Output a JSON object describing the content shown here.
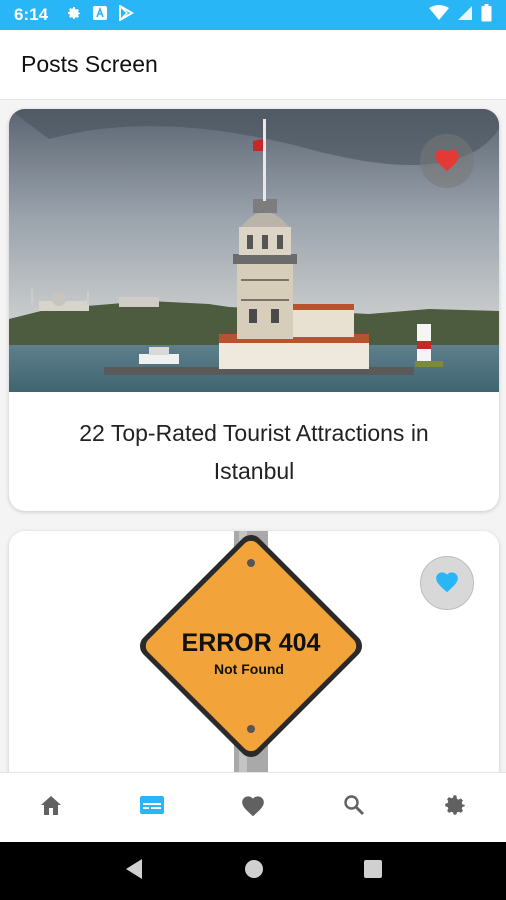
{
  "status_bar": {
    "time": "6:14"
  },
  "app_bar": {
    "title": "Posts Screen"
  },
  "posts": [
    {
      "title": "22 Top-Rated Tourist Attractions in Istanbul",
      "favorited": true,
      "fav_color": "#e53935"
    },
    {
      "sign_title": "ERROR 404",
      "sign_subtitle": "Not Found",
      "favorited": false,
      "fav_color": "#29b6f6"
    }
  ],
  "bottom_nav": {
    "items": [
      {
        "icon": "home-icon",
        "active": false
      },
      {
        "icon": "posts-icon",
        "active": true
      },
      {
        "icon": "heart-icon",
        "active": false
      },
      {
        "icon": "search-icon",
        "active": false
      },
      {
        "icon": "gear-icon",
        "active": false
      }
    ],
    "active_color": "#29b6f6",
    "inactive_color": "#616161"
  },
  "colors": {
    "status_bar": "#29b6f6",
    "accent": "#29b6f6"
  }
}
